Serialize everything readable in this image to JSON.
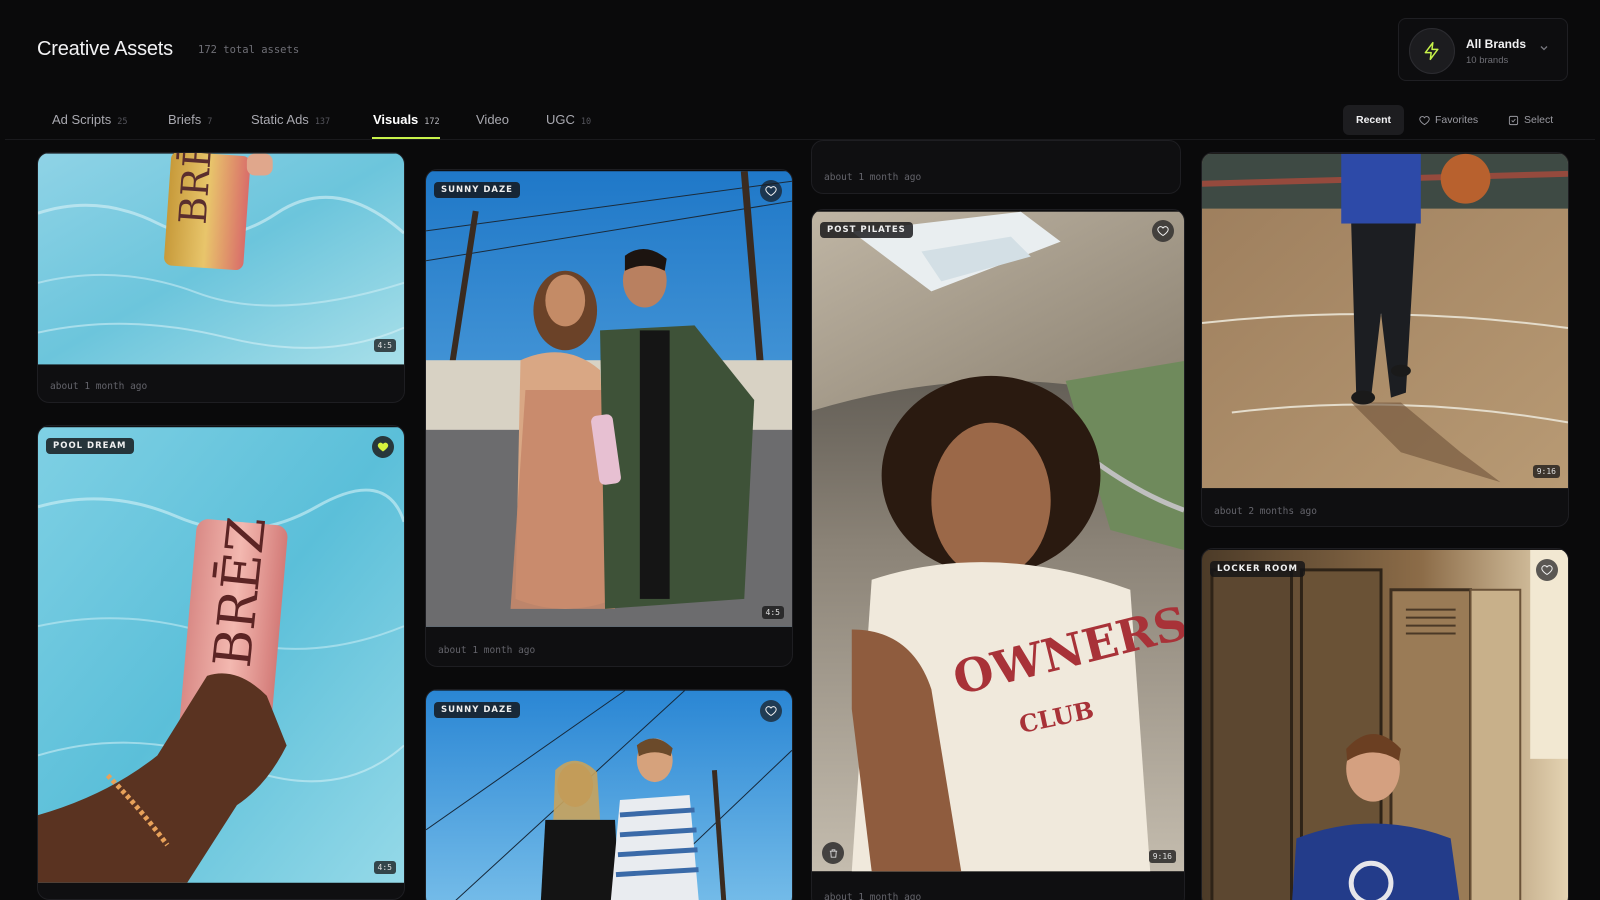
{
  "header": {
    "title": "Creative Assets",
    "asset_count": "172 total assets",
    "brand": {
      "name": "All Brands",
      "sub": "10 brands"
    }
  },
  "tabs": [
    {
      "label": "Ad Scripts",
      "count": "25"
    },
    {
      "label": "Briefs",
      "count": "7"
    },
    {
      "label": "Static Ads",
      "count": "137"
    },
    {
      "label": "Visuals",
      "count": "172"
    },
    {
      "label": "Video",
      "count": ""
    },
    {
      "label": "UGC",
      "count": "10"
    }
  ],
  "view": {
    "recent": "Recent",
    "favorites": "Favorites",
    "select": "Select"
  },
  "cards": {
    "c1": {
      "ratio": "4:5",
      "time": "about 1 month ago"
    },
    "c2": {
      "tag": "POOL DREAM",
      "ratio": "4:5"
    },
    "c3": {
      "tag": "SUNNY DAZE",
      "ratio": "4:5",
      "time": "about 1 month ago"
    },
    "c4": {
      "tag": "SUNNY DAZE"
    },
    "c5": {
      "time": "about 1 month ago"
    },
    "c6": {
      "tag": "POST PILATES",
      "ratio": "9:16",
      "time": "about 1 month ago"
    },
    "c7": {
      "ratio": "9:16",
      "time": "about 2 months ago"
    },
    "c8": {
      "tag": "LOCKER ROOM"
    }
  },
  "colors": {
    "accent": "#c7f24a",
    "background": "#0a0a0b"
  }
}
